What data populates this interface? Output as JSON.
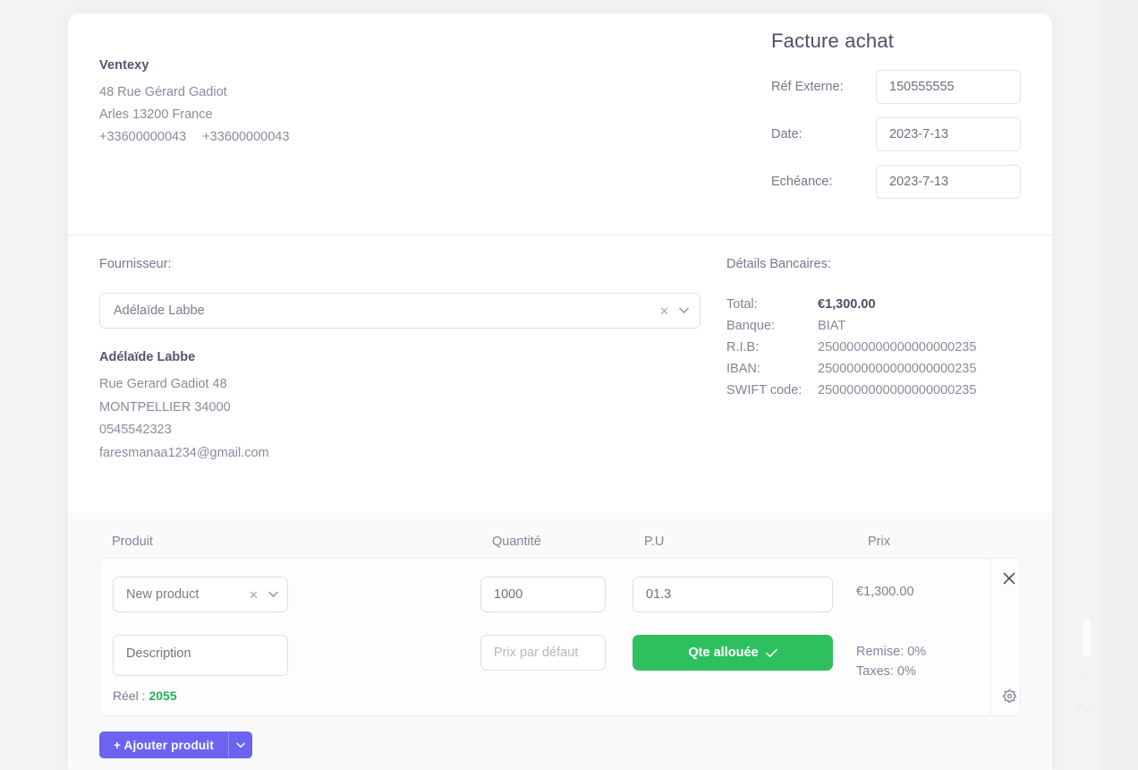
{
  "page": {
    "background": "#f4f4f5",
    "card_background": "#ffffff",
    "accent_purple": "#6c63f2",
    "accent_green": "#2ec05e",
    "text_muted": "#8a8a9e"
  },
  "company": {
    "name": "Ventexy",
    "address_line1": "48 Rue Gérard Gadiot",
    "address_line2": "Arles 13200 France",
    "phone1": "+33600000043",
    "phone2": "+33600000043"
  },
  "invoice": {
    "title": "Facture achat",
    "fields": [
      {
        "label": "Réf Externe:",
        "value": "150555555",
        "placeholder": "Réf Externe"
      },
      {
        "label": "Date:",
        "value": "2023-7-13",
        "placeholder": "Date"
      },
      {
        "label": "Echéance:",
        "value": "2023-7-13",
        "placeholder": "Echéance"
      }
    ]
  },
  "supplier": {
    "label": "Fournisseur:",
    "selected": "Adélaïde Labbe",
    "clear_icon": "close-icon",
    "caret_icon": "chevron-down-icon",
    "detail": {
      "name": "Adélaïde Labbe",
      "address": "Rue Gerard Gadiot 48",
      "city": "MONTPELLIER 34000",
      "phone": "0545542323",
      "email": "faresmanaa1234@gmail.com"
    }
  },
  "bank": {
    "title": "Détails Bancaires:",
    "rows": [
      {
        "key": "Total:",
        "value": "€1,300.00",
        "strong": true
      },
      {
        "key": "Banque:",
        "value": "BIAT",
        "strong": false
      },
      {
        "key": "R.I.B:",
        "value": "2500000000000000000235",
        "strong": false
      },
      {
        "key": "IBAN:",
        "value": "2500000000000000000235",
        "strong": false
      },
      {
        "key": "SWIFT code:",
        "value": "2500000000000000000235",
        "strong": false
      }
    ]
  },
  "products": {
    "columns": {
      "produit": "Produit",
      "quantite": "Quantité",
      "pu": "P.U",
      "prix": "Prix"
    },
    "line": {
      "product_value": "New product",
      "product_clear_icon": "close-icon",
      "product_caret_icon": "chevron-down-icon",
      "description_placeholder": "Description",
      "description_value": "",
      "reel_label": "Réel :",
      "reel_value": "2055",
      "quantity_value": "1000",
      "quantity_placeholder": "Quantité",
      "default_price_placeholder": "Prix par défaut",
      "default_price_value": "",
      "pu_value": "01.3",
      "pu_placeholder": "P.U",
      "alloc_button_label": "Qte allouée",
      "alloc_button_icon": "check-icon",
      "price_total": "€1,300.00",
      "remise": "Remise: 0%",
      "taxes": "Taxes: 0%",
      "remove_icon": "close-icon",
      "settings_icon": "gear-icon"
    },
    "add_button_label": "+  Ajouter produit",
    "add_button_caret_icon": "chevron-down-icon"
  }
}
